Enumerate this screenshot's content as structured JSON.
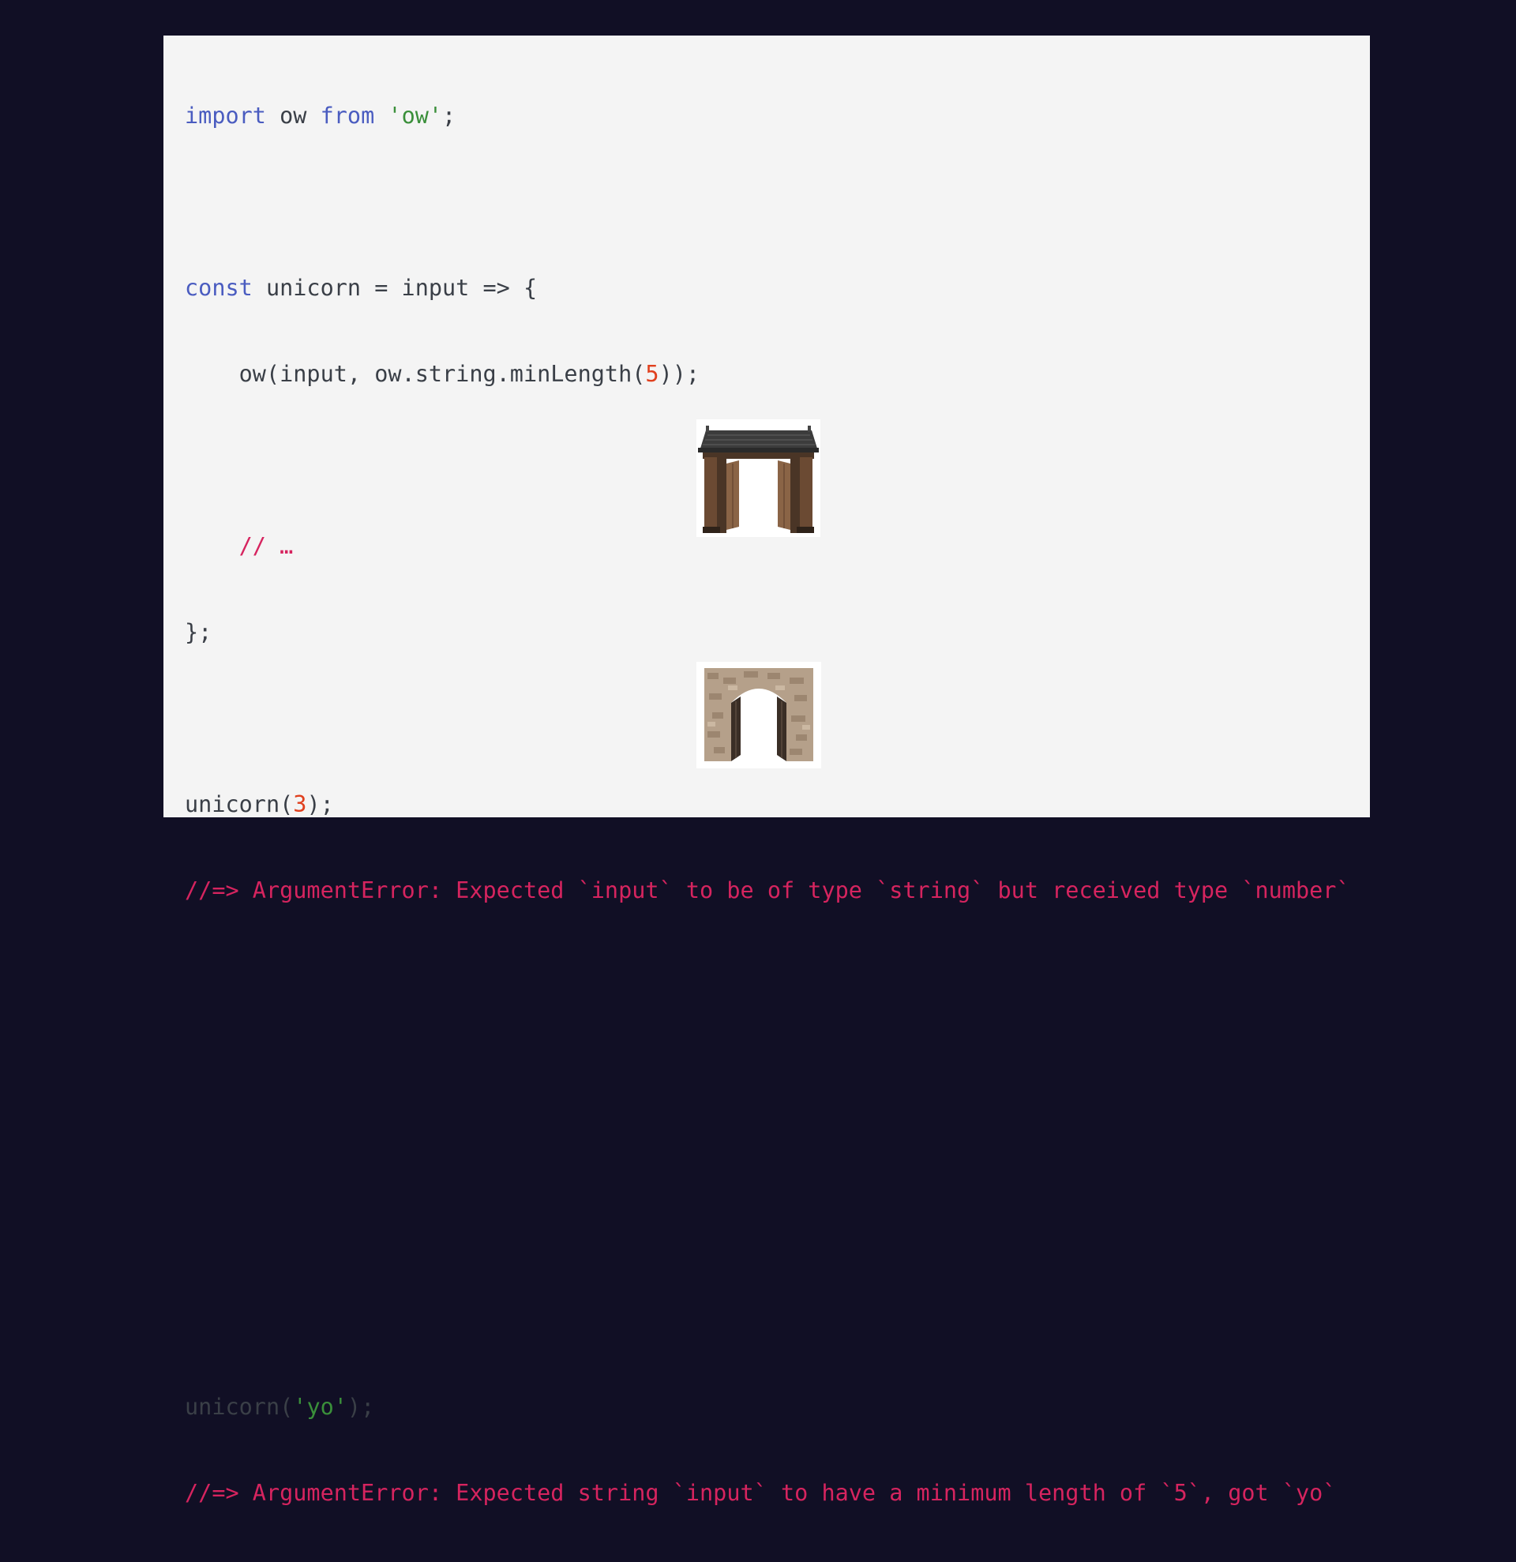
{
  "code": {
    "import_kw": "import",
    "import_name": " ow ",
    "from_kw": "from",
    "import_module": "'ow'",
    "import_end": ";",
    "const_kw": "const",
    "const_rest": " unicorn = input => {",
    "ow_call_start": "    ow(input, ow.string.minLength(",
    "ow_call_num": "5",
    "ow_call_end": "));",
    "comment": "    // …",
    "close": "};",
    "call1_start": "unicorn(",
    "call1_num": "3",
    "call1_end": ");",
    "error1": "//=> ArgumentError: Expected `input` to be of type `string` but received type `number`",
    "call2_start": "unicorn(",
    "call2_str": "'yo'",
    "call2_end": ");",
    "error2": "//=> ArgumentError: Expected string `input` to have a minimum length of `5`, got `yo`"
  },
  "illustrations": {
    "gate_1": "wooden-gate-icon",
    "gate_2": "stone-gate-icon"
  },
  "colors": {
    "background": "#110f25",
    "slide": "#f4f4f4",
    "keyword": "#4a5cc0",
    "string": "#3a8f3a",
    "number": "#e0401e",
    "error": "#d6245f"
  }
}
